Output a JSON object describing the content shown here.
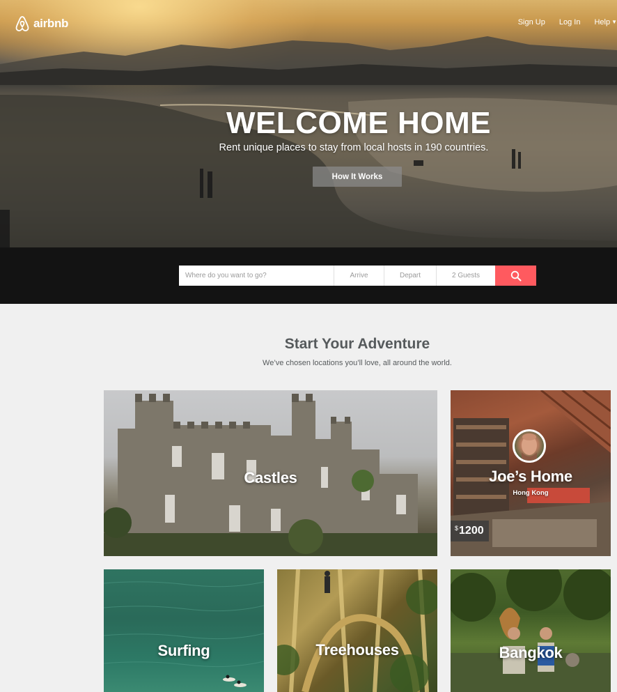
{
  "brand": {
    "name": "airbnb",
    "logo_icon": "airbnb-belo-icon"
  },
  "nav": {
    "sign_up": "Sign Up",
    "log_in": "Log In",
    "help": "Help"
  },
  "hero": {
    "title": "WELCOME HOME",
    "subtitle": "Rent unique places to stay from local hosts in 190 countries.",
    "cta": "How It Works"
  },
  "search": {
    "where_placeholder": "Where do you want to go?",
    "arrive": "Arrive",
    "depart": "Depart",
    "guests": "2 Guests",
    "button_icon": "search-icon",
    "button_color": "#ff5a5f"
  },
  "section": {
    "title": "Start Your Adventure",
    "subtitle": "We’ve chosen locations you’ll love, all around the world."
  },
  "cards": {
    "castles": {
      "label": "Castles"
    },
    "joes_home": {
      "label": "Joe’s Home",
      "city": "Hong Kong",
      "currency": "$",
      "price": "1200"
    },
    "surfing": {
      "label": "Surfing"
    },
    "treehouses": {
      "label": "Treehouses"
    },
    "bangkok": {
      "label": "Bangkok"
    }
  }
}
